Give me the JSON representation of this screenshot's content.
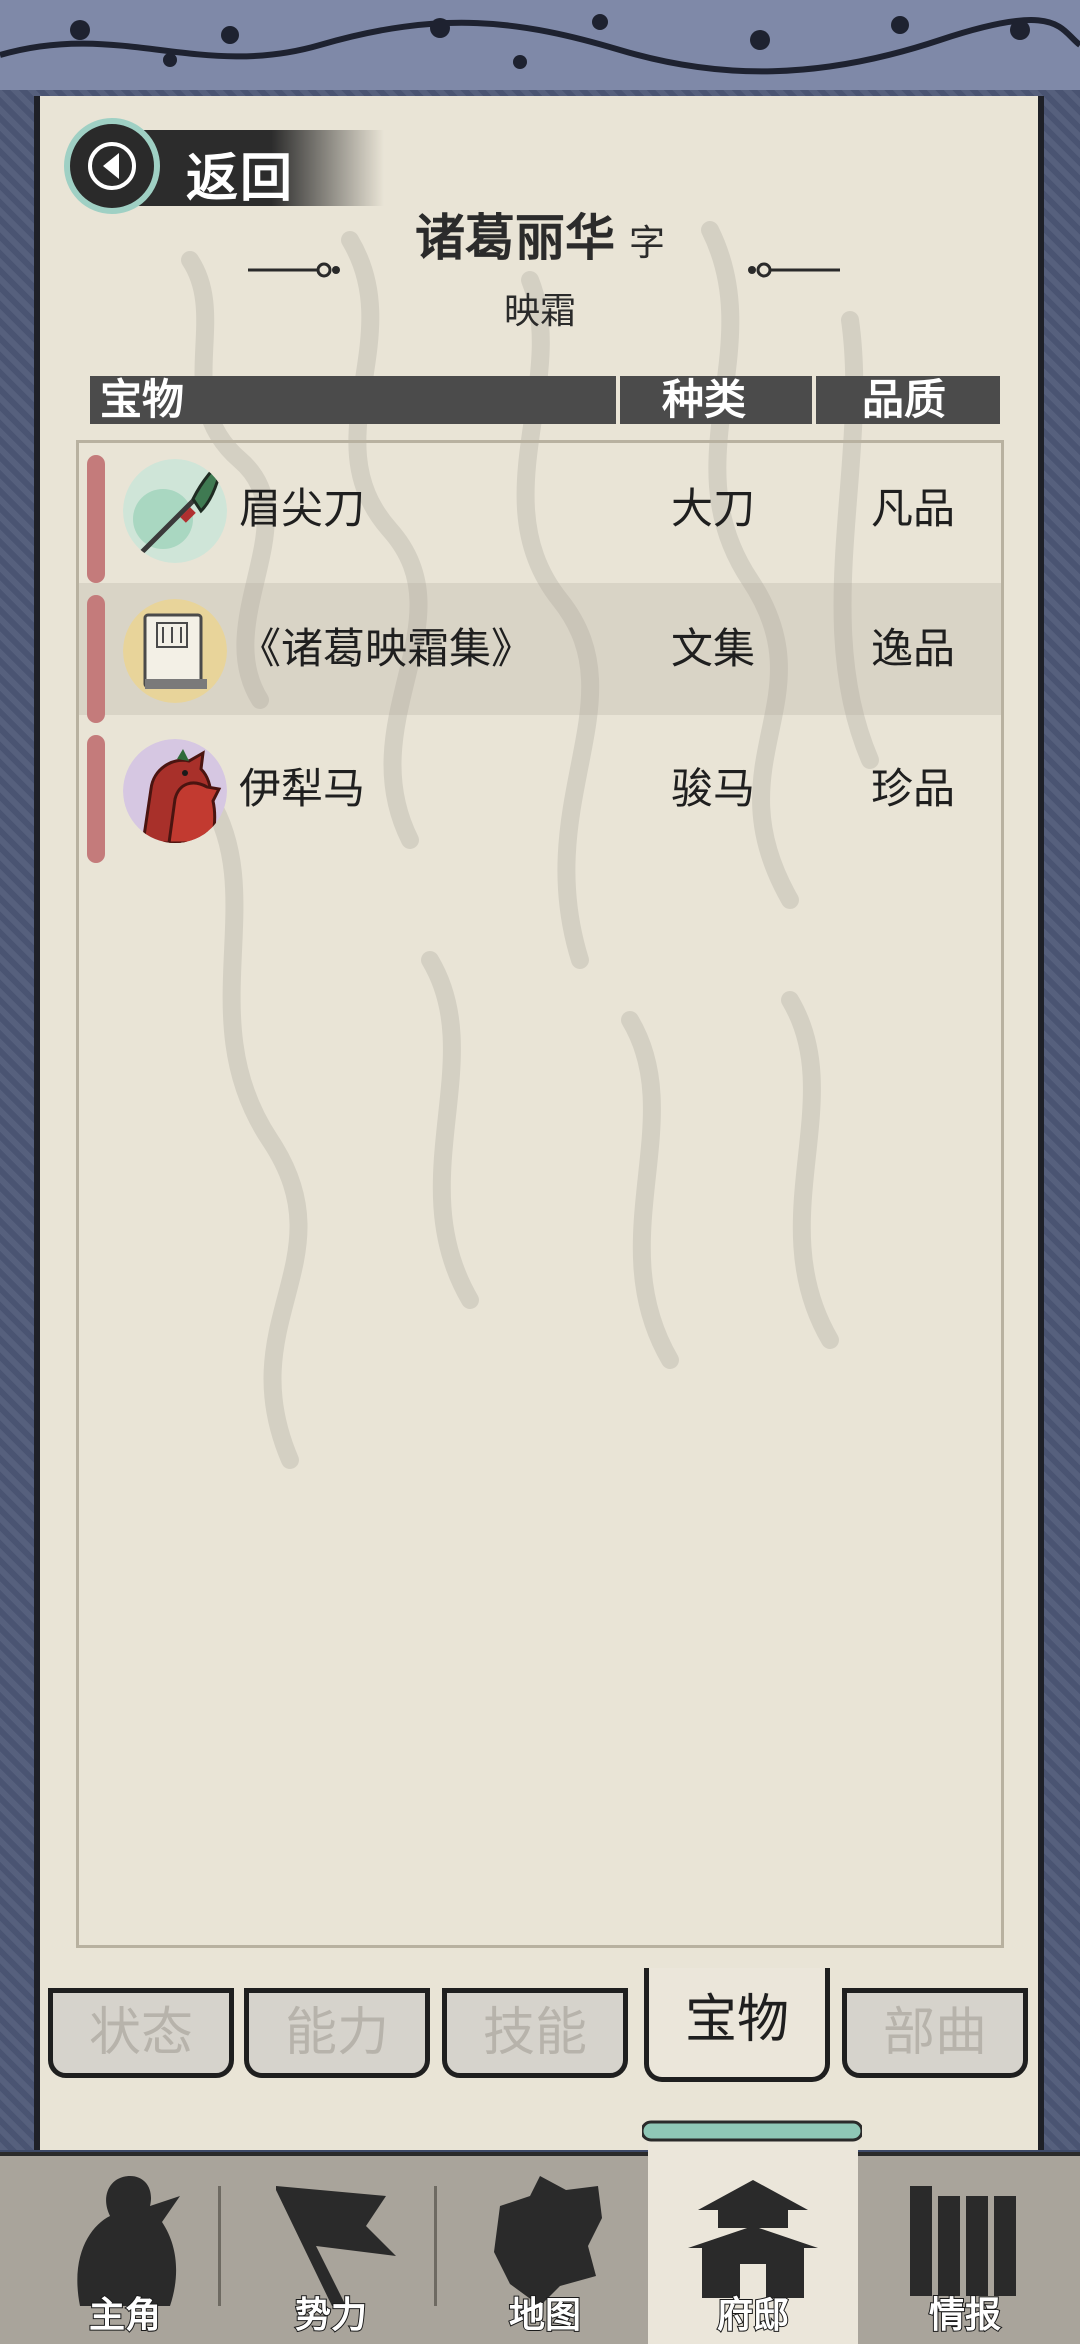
{
  "back_label": "返回",
  "character": {
    "name": "诸葛丽华",
    "zi_label": "字",
    "style_name": "映霜"
  },
  "columns": {
    "item": "宝物",
    "type": "种类",
    "quality": "品质"
  },
  "items": [
    {
      "name": "眉尖刀",
      "type": "大刀",
      "quality": "凡品",
      "icon": "glaive-icon"
    },
    {
      "name": "《诸葛映霜集》",
      "type": "文集",
      "quality": "逸品",
      "icon": "book-icon"
    },
    {
      "name": "伊犁马",
      "type": "骏马",
      "quality": "珍品",
      "icon": "horse-icon"
    }
  ],
  "tabs": [
    {
      "label": "状态",
      "active": false
    },
    {
      "label": "能力",
      "active": false
    },
    {
      "label": "技能",
      "active": false
    },
    {
      "label": "宝物",
      "active": true
    },
    {
      "label": "部曲",
      "active": false
    }
  ],
  "nav": [
    {
      "label": "主角",
      "icon": "warrior-icon",
      "active": false
    },
    {
      "label": "势力",
      "icon": "flag-icon",
      "active": false
    },
    {
      "label": "地图",
      "icon": "map-icon",
      "active": false
    },
    {
      "label": "府邸",
      "icon": "mansion-icon",
      "active": true
    },
    {
      "label": "情报",
      "icon": "scroll-icon",
      "active": false
    }
  ],
  "colors": {
    "paper": "#e9e4d6",
    "frame": "#4a5472",
    "accent_teal": "#9fd0c4",
    "rarity_bar": "#c47b7b",
    "nav_bg": "#a9a49b"
  }
}
